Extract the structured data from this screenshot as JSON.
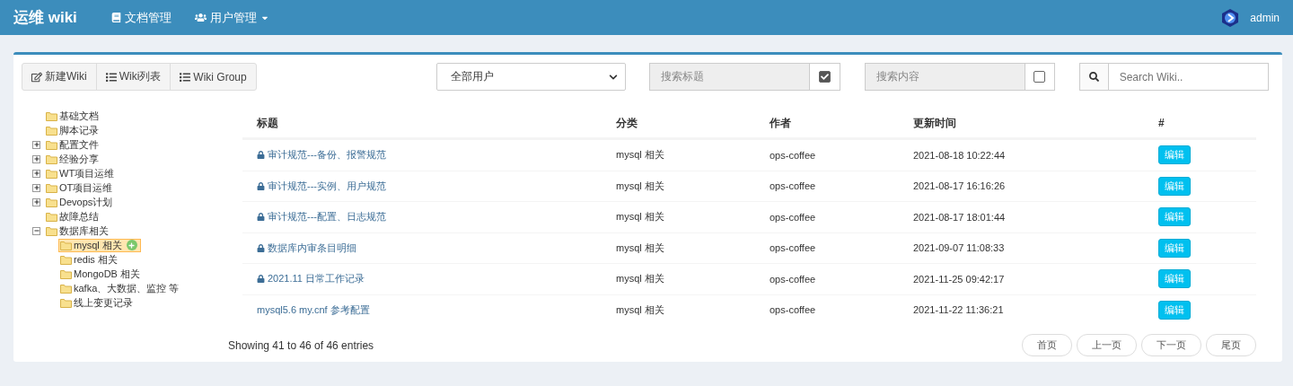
{
  "navbar": {
    "brand": "运维 wiki",
    "menu": [
      {
        "label": "文档管理",
        "dropdown": false
      },
      {
        "label": "用户管理",
        "dropdown": true
      }
    ],
    "user": "admin"
  },
  "toolbar": {
    "buttons": [
      {
        "label": "新建Wiki"
      },
      {
        "label": "Wiki列表"
      },
      {
        "label": "Wiki Group"
      }
    ],
    "user_select": {
      "value": "全部用户"
    },
    "title_search": {
      "placeholder": "搜索标题",
      "checked": true
    },
    "content_search": {
      "placeholder": "搜索内容",
      "checked": false
    },
    "wiki_search": {
      "placeholder": "Search Wiki.."
    }
  },
  "tree": [
    {
      "label": "基础文档",
      "kind": "leaf",
      "selected": false
    },
    {
      "label": "脚本记录",
      "kind": "leaf",
      "selected": false
    },
    {
      "label": "配置文件",
      "kind": "collapsed",
      "selected": false
    },
    {
      "label": "经验分享",
      "kind": "collapsed",
      "selected": false
    },
    {
      "label": "WT项目运维",
      "kind": "collapsed",
      "selected": false
    },
    {
      "label": "OT项目运维",
      "kind": "collapsed",
      "selected": false
    },
    {
      "label": "Devops计划",
      "kind": "collapsed",
      "selected": false
    },
    {
      "label": "故障总结",
      "kind": "leaf",
      "selected": false
    },
    {
      "label": "数据库相关",
      "kind": "expanded",
      "selected": false,
      "children": [
        {
          "label": "mysql 相关",
          "kind": "leaf",
          "selected": true
        },
        {
          "label": "redis 相关",
          "kind": "leaf",
          "selected": false
        },
        {
          "label": "MongoDB 相关",
          "kind": "leaf",
          "selected": false
        },
        {
          "label": "kafka、大数据、监控 等",
          "kind": "leaf",
          "selected": false
        },
        {
          "label": "线上变更记录",
          "kind": "leaf",
          "selected": false
        }
      ]
    }
  ],
  "table": {
    "columns": [
      "标题",
      "分类",
      "作者",
      "更新时间",
      "#"
    ],
    "rows": [
      {
        "title": "审计规范---备份、报警规范",
        "locked": true,
        "category": "mysql 相关",
        "author": "ops-coffee",
        "updated": "2021-08-18 10:22:44",
        "action": "编辑"
      },
      {
        "title": "审计规范---实例、用户规范",
        "locked": true,
        "category": "mysql 相关",
        "author": "ops-coffee",
        "updated": "2021-08-17 16:16:26",
        "action": "编辑"
      },
      {
        "title": "审计规范---配置、日志规范",
        "locked": true,
        "category": "mysql 相关",
        "author": "ops-coffee",
        "updated": "2021-08-17 18:01:44",
        "action": "编辑"
      },
      {
        "title": "数据库内审条目明细",
        "locked": true,
        "category": "mysql 相关",
        "author": "ops-coffee",
        "updated": "2021-09-07 11:08:33",
        "action": "编辑"
      },
      {
        "title": "2021.11 日常工作记录",
        "locked": true,
        "category": "mysql 相关",
        "author": "ops-coffee",
        "updated": "2021-11-25 09:42:17",
        "action": "编辑"
      },
      {
        "title": "mysql5.6 my.cnf 参考配置",
        "locked": false,
        "category": "mysql 相关",
        "author": "ops-coffee",
        "updated": "2021-11-22 11:36:21",
        "action": "编辑"
      }
    ],
    "info": "Showing 41 to 46 of 46 entries",
    "pagination": [
      "首页",
      "上一页",
      "下一页",
      "尾页"
    ]
  }
}
